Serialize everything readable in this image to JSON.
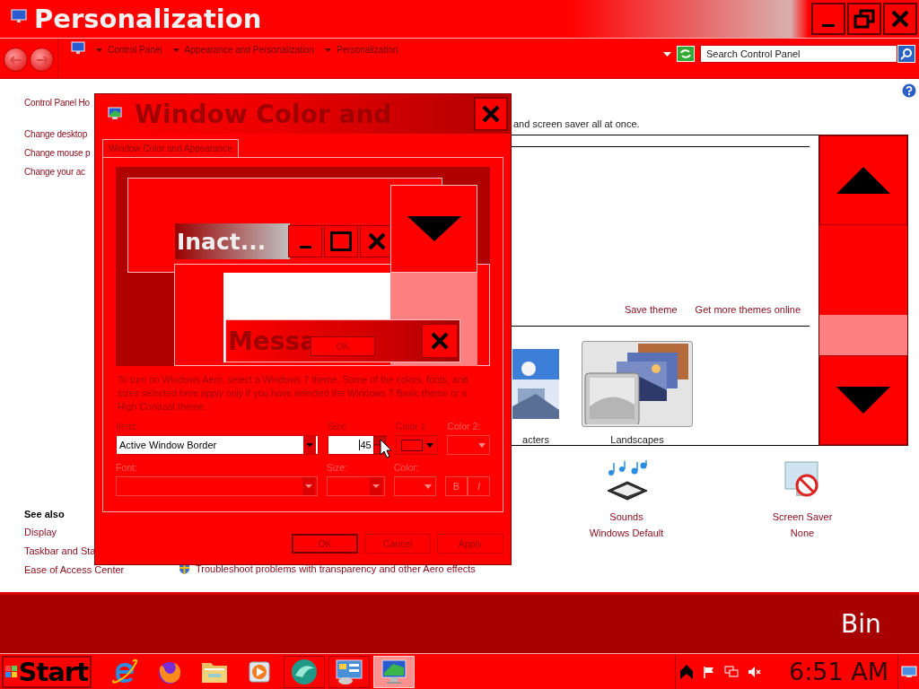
{
  "window": {
    "title": "Personalization",
    "breadcrumb": [
      "Control Panel",
      "Appearance and Personalization",
      "Personalization"
    ],
    "search": {
      "placeholder": "Search Control Panel"
    }
  },
  "sidebar": {
    "links": [
      "Control Panel Ho",
      "Change desktop",
      "Change mouse p",
      "Change your ac"
    ],
    "see_also_heading": "See also",
    "see_also": [
      "Display",
      "Taskbar and Sta",
      "Ease of Access Center"
    ]
  },
  "content": {
    "intro": "and screen saver all at once.",
    "theme_links": [
      "Save theme",
      "Get more themes online"
    ],
    "themes": [
      {
        "name": "acters",
        "selected": false
      },
      {
        "name": "Landscapes",
        "selected": true
      }
    ],
    "settings": [
      {
        "kind": "sounds",
        "name": "Sounds",
        "value": "Windows Default"
      },
      {
        "kind": "screensaver",
        "name": "Screen Saver",
        "value": "None"
      }
    ],
    "troubleshoot": "Troubleshoot problems with transparency and other Aero effects"
  },
  "dialog": {
    "title": "Window Color and",
    "tabs": [
      {
        "label": "Window Color and Appearance",
        "selected": true
      }
    ],
    "preview": {
      "inactive_title": "Inact...",
      "message_title": "Messa",
      "message_button": "OK"
    },
    "description": "To turn on Windows Aero, select a Windows 7 theme. Some of the colors, fonts, and sizes selected here apply only if you have selected the Windows 7 Basic theme or a High Contrast theme.",
    "rows": [
      [
        {
          "kind": "dropdown",
          "label": "Item:",
          "value": "Active Window Border",
          "disabled": false
        },
        {
          "kind": "spin",
          "label": "Size:",
          "value": "45",
          "disabled": false
        },
        {
          "kind": "color",
          "label": "Color 1:",
          "disabled": false
        },
        {
          "kind": "color",
          "label": "Color 2:",
          "disabled": true
        }
      ],
      [
        {
          "kind": "dropdown",
          "label": "Font:",
          "disabled": true
        },
        {
          "kind": "dropdown",
          "label": "Size:",
          "disabled": true
        },
        {
          "kind": "color",
          "label": "Color:",
          "disabled": true
        },
        {
          "kind": "toggles",
          "labels": [
            "B",
            "I"
          ],
          "disabled": true
        }
      ]
    ],
    "buttons": [
      {
        "label": "OK",
        "default": true
      },
      {
        "label": "Cancel",
        "default": false
      },
      {
        "label": "Apply",
        "default": false
      }
    ]
  },
  "desktop": {
    "icon_label": "Bin"
  },
  "taskbar": {
    "start": "Start",
    "apps": [
      {
        "kind": "ie",
        "selected": false
      },
      {
        "kind": "firefox",
        "selected": false
      },
      {
        "kind": "folder",
        "selected": false
      },
      {
        "kind": "media",
        "selected": false
      },
      {
        "kind": "orb",
        "selected": false
      },
      {
        "kind": "panel",
        "selected": false
      },
      {
        "kind": "monitor",
        "selected": true
      }
    ],
    "clock": "6:51 AM"
  }
}
